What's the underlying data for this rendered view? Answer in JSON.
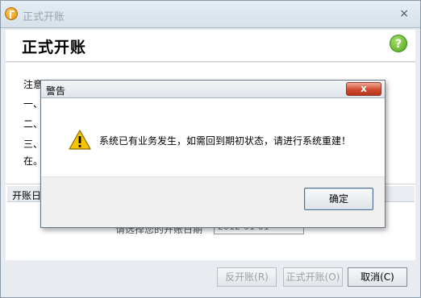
{
  "window": {
    "title": "正式开账",
    "close_glyph": "×"
  },
  "header": {
    "title": "正式开账",
    "help_glyph": "?"
  },
  "notice": {
    "title": "注意事项",
    "lines": [
      "一、",
      "二、",
      "三、",
      "在。"
    ]
  },
  "date_section": {
    "label": "开账日期",
    "prompt": "请选择您的开账日期",
    "date_value": "2012-01-01"
  },
  "buttons": {
    "reverse": "反开账(R)",
    "formal": "正式开账(O)",
    "cancel": "取消(C)"
  },
  "dialog": {
    "title": "警告",
    "close_glyph": "x",
    "message": "系统已有业务发生，如需回到期初状态，请进行系统重建！",
    "ok_label": "确定"
  },
  "colors": {
    "warning_yellow": "#f6c400",
    "close_red": "#cf4a2f",
    "help_green": "#4ea21c"
  }
}
